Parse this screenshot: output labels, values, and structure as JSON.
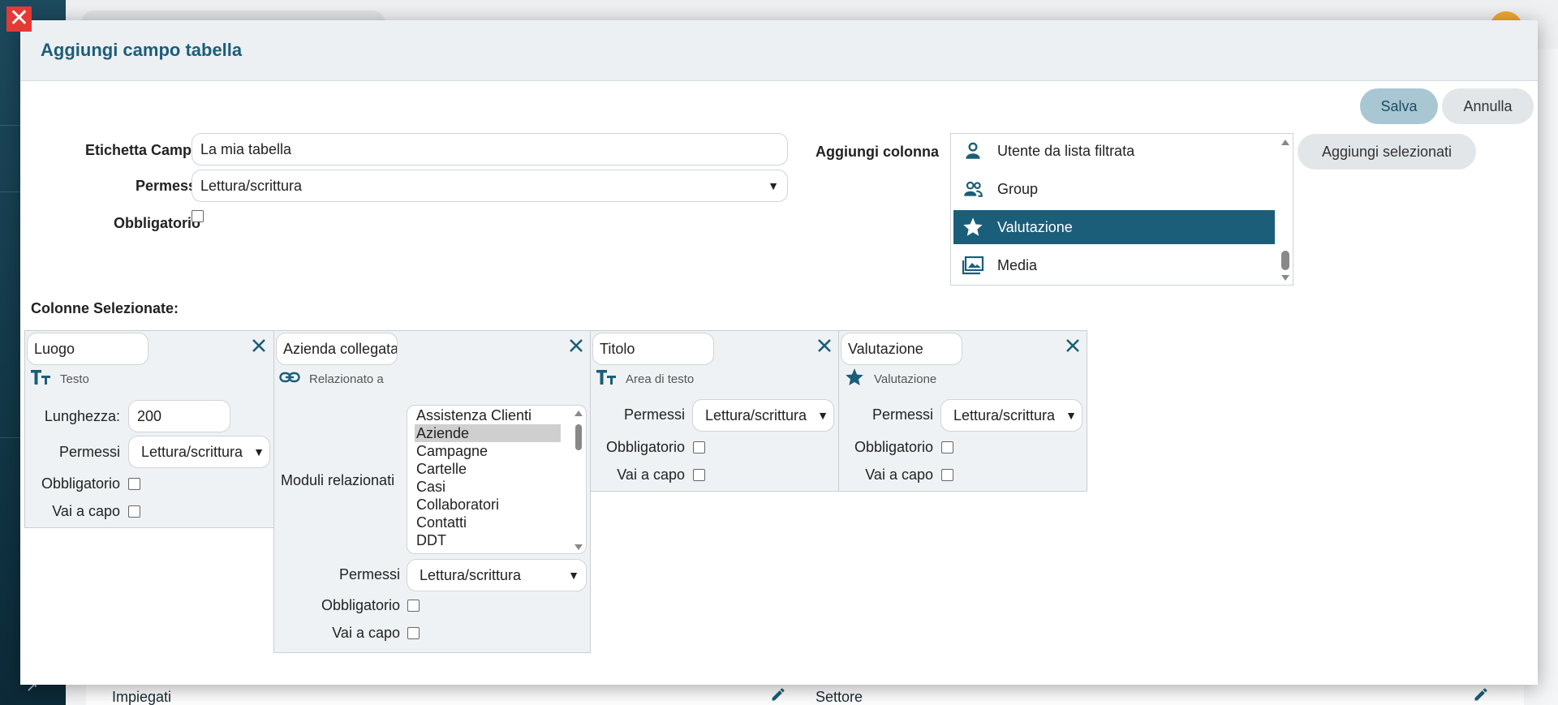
{
  "background": {
    "rows": [
      {
        "label": "Impiegati"
      },
      {
        "label": "Settore"
      }
    ]
  },
  "modal": {
    "title": "Aggiungi campo tabella",
    "save_label": "Salva",
    "cancel_label": "Annulla",
    "fields": {
      "label_label": "Etichetta Campo",
      "label_value": "La mia tabella",
      "permissions_label": "Permessi",
      "permissions_value": "Lettura/scrittura",
      "required_label": "Obbligatorio",
      "required_checked": false
    },
    "add_column": {
      "label": "Aggiungi colonna",
      "button_label": "Aggiungi selezionati",
      "options": [
        {
          "label": "Utente da lista filtrata",
          "icon": "person-icon",
          "selected": false
        },
        {
          "label": "Group",
          "icon": "group-icon",
          "selected": false
        },
        {
          "label": "Valutazione",
          "icon": "star-icon",
          "selected": true
        },
        {
          "label": "Media",
          "icon": "media-icon",
          "selected": false
        }
      ]
    },
    "selected_columns_title": "Colonne Selezionate:",
    "columns": [
      {
        "name": "Luogo",
        "type": "Testo",
        "type_icon": "text-type-icon",
        "length_label": "Lunghezza:",
        "length_value": "200",
        "permissions_label": "Permessi",
        "permissions_value": "Lettura/scrittura",
        "required_label": "Obbligatorio",
        "newline_label": "Vai a capo"
      },
      {
        "name": "Azienda collegata",
        "type": "Relazionato a",
        "type_icon": "link-icon",
        "modules_label": "Moduli relazionati",
        "modules": [
          "Assistenza Clienti",
          "Aziende",
          "Campagne",
          "Cartelle",
          "Casi",
          "Collaboratori",
          "Contatti",
          "DDT"
        ],
        "modules_selected": "Aziende",
        "permissions_label": "Permessi",
        "permissions_value": "Lettura/scrittura",
        "required_label": "Obbligatorio",
        "newline_label": "Vai a capo"
      },
      {
        "name": "Titolo",
        "type": "Area di testo",
        "type_icon": "text-type-icon",
        "permissions_label": "Permessi",
        "permissions_value": "Lettura/scrittura",
        "required_label": "Obbligatorio",
        "newline_label": "Vai a capo"
      },
      {
        "name": "Valutazione",
        "type": "Valutazione",
        "type_icon": "star-icon",
        "permissions_label": "Permessi",
        "permissions_value": "Lettura/scrittura",
        "required_label": "Obbligatorio",
        "newline_label": "Vai a capo"
      }
    ]
  },
  "colors": {
    "accent": "#1b5e79",
    "selected_bg": "#1b5e79",
    "save_bg": "#a9c7d3",
    "close_red": "#e53935"
  }
}
